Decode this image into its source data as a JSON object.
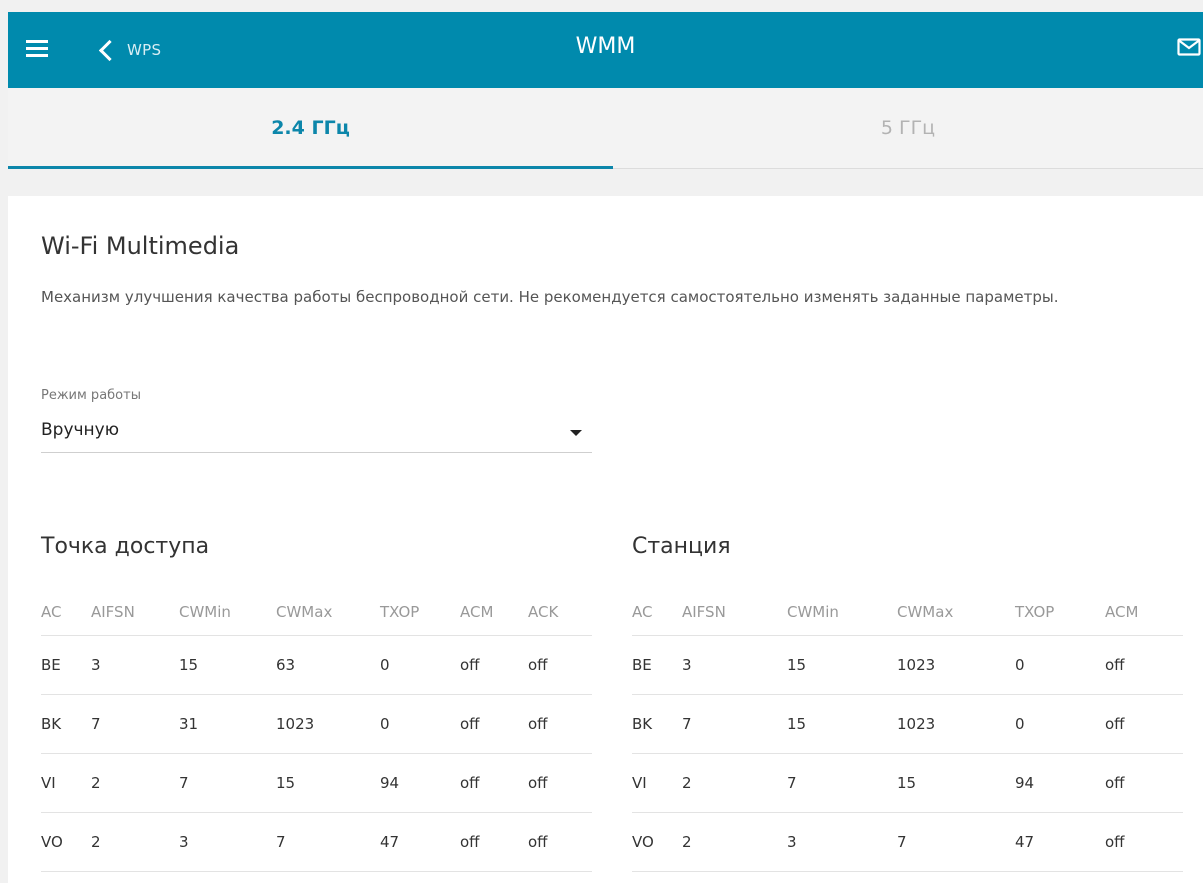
{
  "header": {
    "back_label": "WPS",
    "title": "WMM"
  },
  "tabs": [
    {
      "label": "2.4 ГГц",
      "active": true
    },
    {
      "label": "5 ГГц",
      "active": false
    }
  ],
  "section": {
    "title": "Wi-Fi Multimedia",
    "description": "Механизм улучшения качества работы беспроводной сети. Не рекомендуется самостоятельно изменять заданные параметры."
  },
  "mode": {
    "label": "Режим работы",
    "value": "Вручную"
  },
  "access_point": {
    "title": "Точка доступа",
    "columns": [
      "AC",
      "AIFSN",
      "CWMin",
      "CWMax",
      "TXOP",
      "ACM",
      "ACK"
    ],
    "rows": [
      [
        "BE",
        "3",
        "15",
        "63",
        "0",
        "off",
        "off"
      ],
      [
        "BK",
        "7",
        "31",
        "1023",
        "0",
        "off",
        "off"
      ],
      [
        "VI",
        "2",
        "7",
        "15",
        "94",
        "off",
        "off"
      ],
      [
        "VO",
        "2",
        "3",
        "7",
        "47",
        "off",
        "off"
      ]
    ]
  },
  "station": {
    "title": "Станция",
    "columns": [
      "AC",
      "AIFSN",
      "CWMin",
      "CWMax",
      "TXOP",
      "ACM"
    ],
    "rows": [
      [
        "BE",
        "3",
        "15",
        "1023",
        "0",
        "off"
      ],
      [
        "BK",
        "7",
        "15",
        "1023",
        "0",
        "off"
      ],
      [
        "VI",
        "2",
        "7",
        "15",
        "94",
        "off"
      ],
      [
        "VO",
        "2",
        "3",
        "7",
        "47",
        "off"
      ]
    ]
  },
  "icons": {
    "menu": "menu-icon",
    "back": "chevron-left-icon",
    "mail": "mail-icon",
    "dropdown": "caret-down-icon"
  },
  "colors": {
    "header_bg": "#008aad",
    "accent": "#0c86aa",
    "tab_inactive": "#b3b3b3"
  }
}
